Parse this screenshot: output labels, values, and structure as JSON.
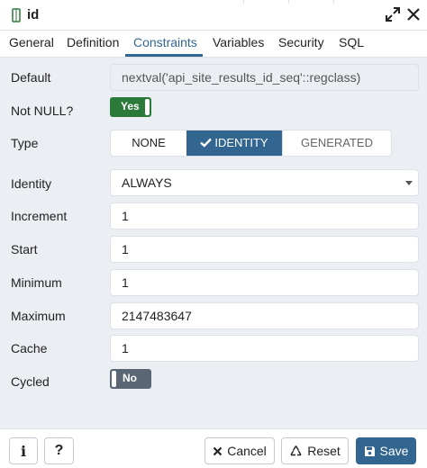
{
  "window": {
    "title": "id",
    "icon": "column-icon",
    "maximize_icon": "expand-icon",
    "close_icon": "close-icon"
  },
  "tabs": [
    {
      "label": "General"
    },
    {
      "label": "Definition"
    },
    {
      "label": "Constraints",
      "active": true
    },
    {
      "label": "Variables"
    },
    {
      "label": "Security"
    },
    {
      "label": "SQL"
    }
  ],
  "form": {
    "default": {
      "label": "Default",
      "value": "nextval('api_site_results_id_seq'::regclass)"
    },
    "not_null": {
      "label": "Not NULL?",
      "toggle_text": "Yes",
      "state": true
    },
    "type": {
      "label": "Type",
      "options": [
        {
          "label": "NONE"
        },
        {
          "label": "IDENTITY",
          "selected": true
        },
        {
          "label": "GENERATED"
        }
      ]
    },
    "identity": {
      "label": "Identity",
      "value": "ALWAYS"
    },
    "increment": {
      "label": "Increment",
      "value": "1"
    },
    "start": {
      "label": "Start",
      "value": "1"
    },
    "minimum": {
      "label": "Minimum",
      "value": "1"
    },
    "maximum": {
      "label": "Maximum",
      "value": "2147483647"
    },
    "cache": {
      "label": "Cache",
      "value": "1"
    },
    "cycled": {
      "label": "Cycled",
      "toggle_text": "No",
      "state": false
    }
  },
  "footer": {
    "info_label": "i",
    "help_label": "?",
    "cancel_label": "Cancel",
    "reset_label": "Reset",
    "save_label": "Save"
  },
  "colors": {
    "accent": "#326690",
    "toggle_on": "#2c7a3a",
    "toggle_off": "#5b6675",
    "panel_bg": "#ebeef3"
  }
}
